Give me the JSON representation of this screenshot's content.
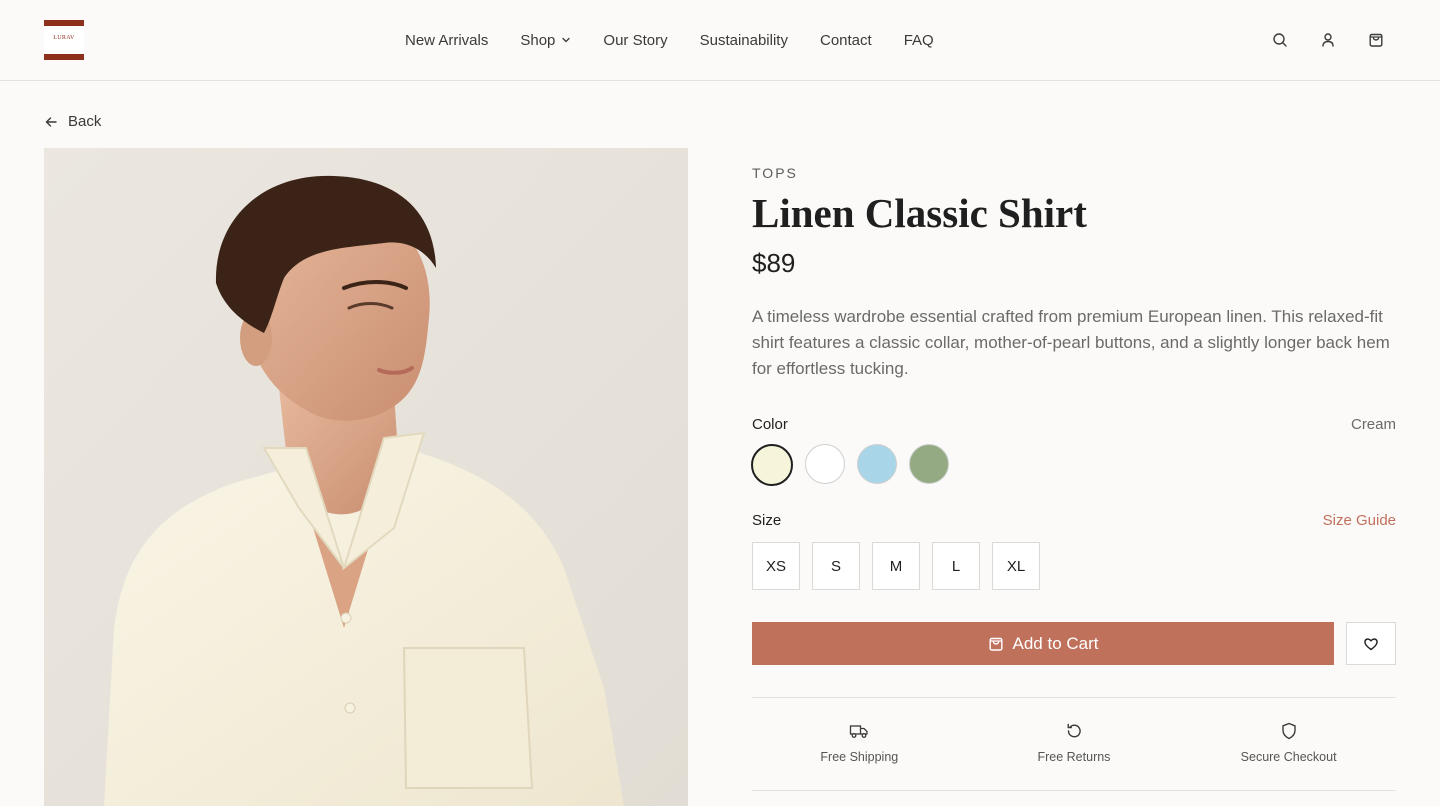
{
  "brand": {
    "logo_text": "LURAV",
    "accent": "#8c2f1c"
  },
  "nav": {
    "items": [
      {
        "label": "New Arrivals"
      },
      {
        "label": "Shop"
      },
      {
        "label": "Our Story"
      },
      {
        "label": "Sustainability"
      },
      {
        "label": "Contact"
      },
      {
        "label": "FAQ"
      }
    ]
  },
  "header_icons": [
    "search-icon",
    "user-icon",
    "shopping-bag-icon"
  ],
  "back": {
    "label": "Back"
  },
  "product": {
    "category": "TOPS",
    "title": "Linen Classic Shirt",
    "price": "$89",
    "description": "A timeless wardrobe essential crafted from premium European linen. This relaxed-fit shirt features a classic collar, mother-of-pearl buttons, and a slightly longer back hem for effortless tucking.",
    "image_alt": "Man wearing cream linen shirt"
  },
  "color": {
    "label": "Color",
    "selected": "Cream",
    "swatches": [
      {
        "name": "Cream",
        "hex": "#f6f5dc"
      },
      {
        "name": "White",
        "hex": "#ffffff"
      },
      {
        "name": "Sky Blue",
        "hex": "#a8d6e8"
      },
      {
        "name": "Sage",
        "hex": "#93aa82"
      }
    ]
  },
  "size": {
    "label": "Size",
    "guide_label": "Size Guide",
    "options": [
      "XS",
      "S",
      "M",
      "L",
      "XL"
    ]
  },
  "actions": {
    "add_to_cart": "Add to Cart",
    "primary_color": "#c0715c"
  },
  "features": [
    {
      "icon": "truck-icon",
      "label": "Free Shipping"
    },
    {
      "icon": "rotate-ccw-icon",
      "label": "Free Returns"
    },
    {
      "icon": "shield-icon",
      "label": "Secure Checkout"
    }
  ]
}
